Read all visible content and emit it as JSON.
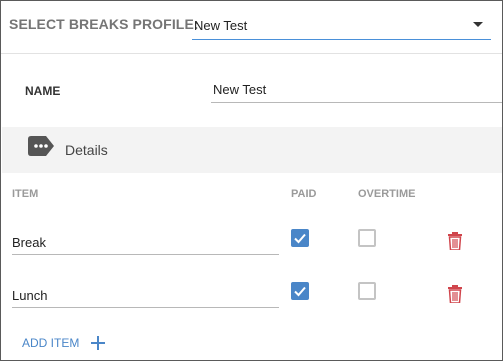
{
  "header": {
    "profile_label": "SELECT BREAKS PROFILE:",
    "profile_value": "New Test"
  },
  "form": {
    "name_label": "NAME",
    "name_value": "New Test"
  },
  "details": {
    "title": "Details",
    "icon": "more-tag-icon"
  },
  "table": {
    "headers": {
      "item": "ITEM",
      "paid": "PAID",
      "overtime": "OVERTIME"
    },
    "rows": [
      {
        "item": "Break",
        "paid": true,
        "overtime": false
      },
      {
        "item": "Lunch",
        "paid": true,
        "overtime": false
      }
    ]
  },
  "actions": {
    "add_item": "ADD ITEM"
  },
  "colors": {
    "accent": "#4a86c8",
    "delete": "#d0454c"
  }
}
